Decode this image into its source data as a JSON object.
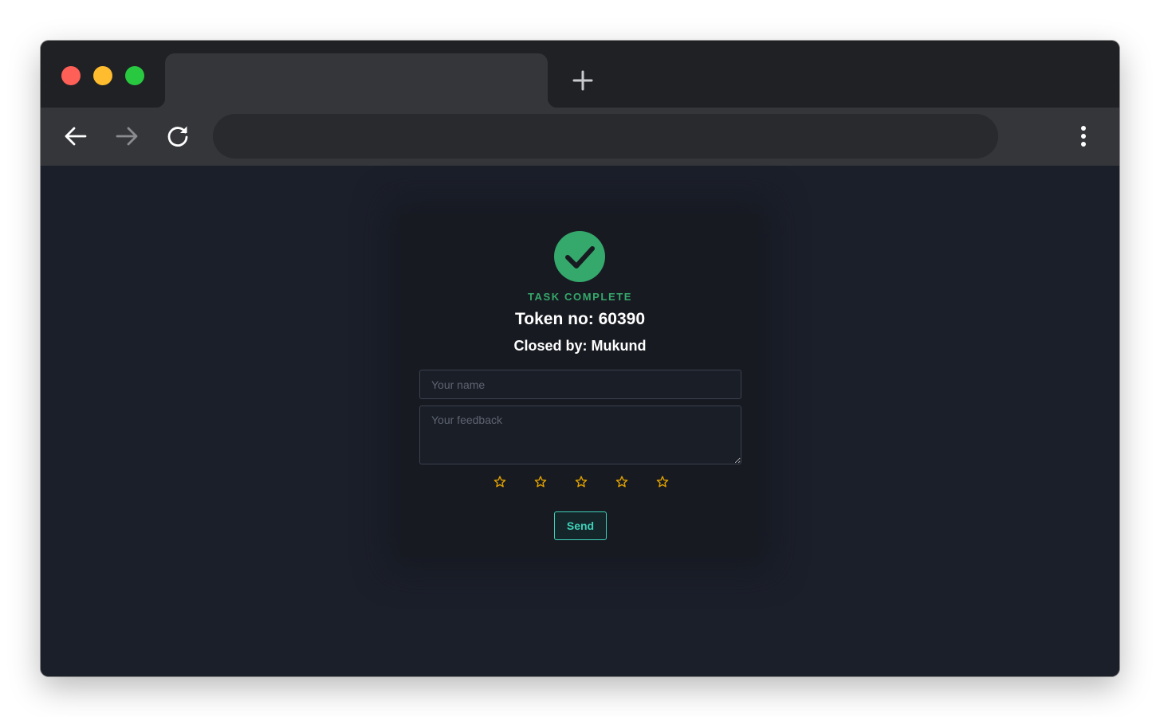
{
  "browser": {
    "tab_title": "",
    "address": "",
    "colors": {
      "titlebar": "#202124",
      "toolbar": "#35363a",
      "omnibox": "#292a2d"
    }
  },
  "card": {
    "status_label": "TASK COMPLETE",
    "token_line": "Token no: 60390",
    "closed_by_line": "Closed by: Mukund",
    "name_placeholder": "Your name",
    "feedback_placeholder": "Your feedback",
    "rating": {
      "max": 5,
      "selected": 0,
      "icon": "star-outline-icon"
    },
    "send_label": "Send",
    "colors": {
      "success": "#35a86b",
      "accent": "#3fd0b8",
      "star": "#e0a100"
    }
  }
}
